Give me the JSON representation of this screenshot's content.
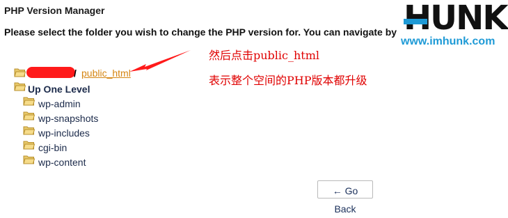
{
  "page": {
    "title": "PHP Version Manager",
    "instructions": "Please select the folder you wish to change the PHP version for. You can navigate by clicking on the ic"
  },
  "watermark": {
    "brand": "HUNK",
    "url": "www.imhunk.com"
  },
  "tree": {
    "current_path_separator": "/",
    "current_folder_link": "public_html",
    "up_one_level": "Up One Level",
    "subfolders": [
      "wp-admin",
      "wp-snapshots",
      "wp-includes",
      "cgi-bin",
      "wp-content"
    ]
  },
  "annotations": {
    "line1": "然后点击public_html",
    "line2": "表示整个空间的PHP版本都升级"
  },
  "actions": {
    "go_back": "← Go Back"
  },
  "colors": {
    "link": "#d58512",
    "annotation": "#e00000",
    "brand_blue": "#1e9ad6"
  }
}
